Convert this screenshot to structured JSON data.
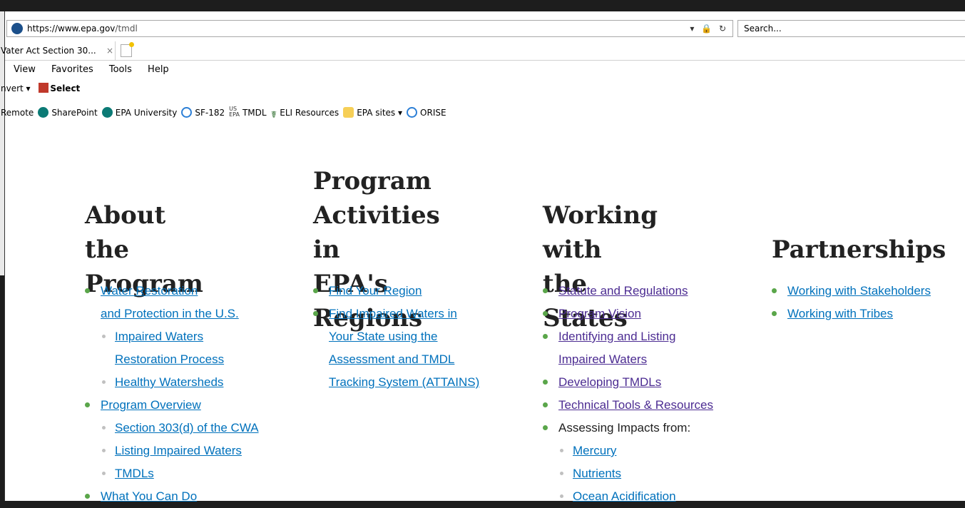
{
  "browser": {
    "url_host": "https://www.epa.gov",
    "url_path": "/tmdl",
    "address_tools": "▾ 🔒 ↻",
    "search_placeholder": "Search...",
    "tab_title": "Vater Act Section 30...",
    "tab_close": "×",
    "menu": [
      "View",
      "Favorites",
      "Tools",
      "Help"
    ],
    "command_bar": {
      "convert": "nvert ▾",
      "select": "Select"
    },
    "favorites": [
      {
        "label": "Remote",
        "icon": "partial-icon"
      },
      {
        "label": "SharePoint",
        "icon": "sharepoint-icon"
      },
      {
        "label": "EPA University",
        "icon": "sharepoint-icon"
      },
      {
        "label": "SF-182",
        "icon": "ie-icon"
      },
      {
        "label": "TMDL",
        "icon": "us-epa-icon"
      },
      {
        "label": "ELI Resources",
        "icon": "eli-icon"
      },
      {
        "label": "EPA sites ▾",
        "icon": "folder-icon"
      },
      {
        "label": "ORISE",
        "icon": "ie-icon"
      }
    ]
  },
  "columns": [
    {
      "heading_lines": [
        "About the",
        "Program"
      ],
      "items": [
        {
          "text": "Water Restoration",
          "level": 0,
          "link": true
        },
        {
          "text": "and Protection in the U.S.",
          "level": 0,
          "link": true,
          "cont": true
        },
        {
          "text": "Impaired Waters",
          "level": 1,
          "link": true
        },
        {
          "text": "Restoration Process",
          "level": 1,
          "link": true,
          "cont": true
        },
        {
          "text": "Healthy Watersheds",
          "level": 1,
          "link": true
        },
        {
          "text": "Program Overview",
          "level": 0,
          "link": true
        },
        {
          "text": "Section 303(d) of the CWA",
          "level": 1,
          "link": true
        },
        {
          "text": "Listing Impaired Waters",
          "level": 1,
          "link": true
        },
        {
          "text": "TMDLs",
          "level": 1,
          "link": true
        },
        {
          "text": "What You Can Do",
          "level": 0,
          "link": true
        }
      ]
    },
    {
      "heading_lines": [
        "Program",
        "Activities in",
        "EPA's Regions"
      ],
      "items": [
        {
          "text": "Find Your Region",
          "level": 0,
          "link": true
        },
        {
          "text": "Find Impaired Waters in",
          "level": 0,
          "link": true
        },
        {
          "text": "Your State using the",
          "level": 0,
          "link": true,
          "cont": true
        },
        {
          "text": "Assessment and TMDL",
          "level": 0,
          "link": true,
          "cont": true
        },
        {
          "text": "Tracking System (ATTAINS)",
          "level": 0,
          "link": true,
          "cont": true
        }
      ]
    },
    {
      "heading_lines": [
        "Working with",
        "the States"
      ],
      "items": [
        {
          "text": "Statute and Regulations",
          "level": 0,
          "link": true,
          "visited": true
        },
        {
          "text": "Program Vision",
          "level": 0,
          "link": true,
          "visited": true
        },
        {
          "text": "Identifying and Listing",
          "level": 0,
          "link": true,
          "visited": true
        },
        {
          "text": "Impaired Waters",
          "level": 0,
          "link": true,
          "visited": true,
          "cont": true
        },
        {
          "text": "Developing TMDLs",
          "level": 0,
          "link": true,
          "visited": true
        },
        {
          "text": "Technical Tools & Resources",
          "level": 0,
          "link": true,
          "visited": true
        },
        {
          "text": "Assessing Impacts from:",
          "level": 0,
          "link": false
        },
        {
          "text": "Mercury",
          "level": 1,
          "link": true
        },
        {
          "text": "Nutrients",
          "level": 1,
          "link": true
        },
        {
          "text": "Ocean Acidification",
          "level": 1,
          "link": true
        }
      ]
    },
    {
      "heading_lines": [
        "Partnerships"
      ],
      "items": [
        {
          "text": "Working with Stakeholders",
          "level": 0,
          "link": true
        },
        {
          "text": "Working with Tribes",
          "level": 0,
          "link": true
        }
      ]
    }
  ],
  "colors": {
    "link": "#0071bc",
    "visited": "#4c2c92",
    "bullet": "#5aa64a"
  }
}
